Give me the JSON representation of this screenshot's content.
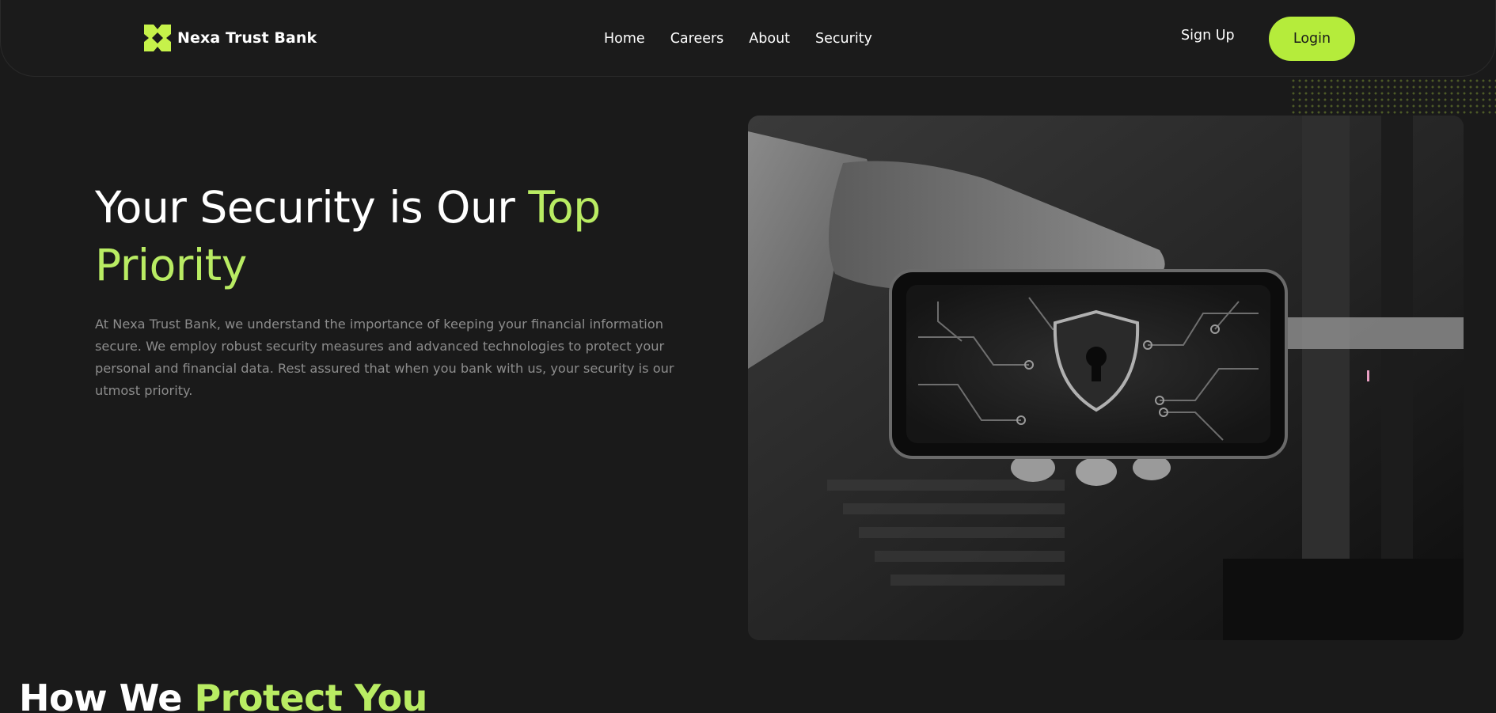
{
  "brand": {
    "name": "Nexa Trust Bank",
    "accent_color": "#b5ec3b",
    "logo_icon": "nexa-x-logo-icon"
  },
  "nav": {
    "items": [
      {
        "label": "Home"
      },
      {
        "label": "Careers"
      },
      {
        "label": "About"
      },
      {
        "label": "Security"
      }
    ],
    "signup_label": "Sign Up",
    "login_label": "Login"
  },
  "hero": {
    "title_main": "Your Security is Our ",
    "title_accent": "Top Priority",
    "body": "At Nexa Trust Bank, we understand the importance of keeping your financial information secure. We employ robust security measures and advanced technologies to protect your personal and financial data. Rest assured that when you bank with us, your security is our utmost priority.",
    "image_subject": "hand holding phone with shield lock icon"
  },
  "section": {
    "title_main": "How We ",
    "title_accent": "Protect You"
  },
  "colors": {
    "background": "#1a1a1a",
    "text": "#ffffff",
    "muted_text": "#8c8c8c",
    "accent_text": "#b9ec63"
  }
}
